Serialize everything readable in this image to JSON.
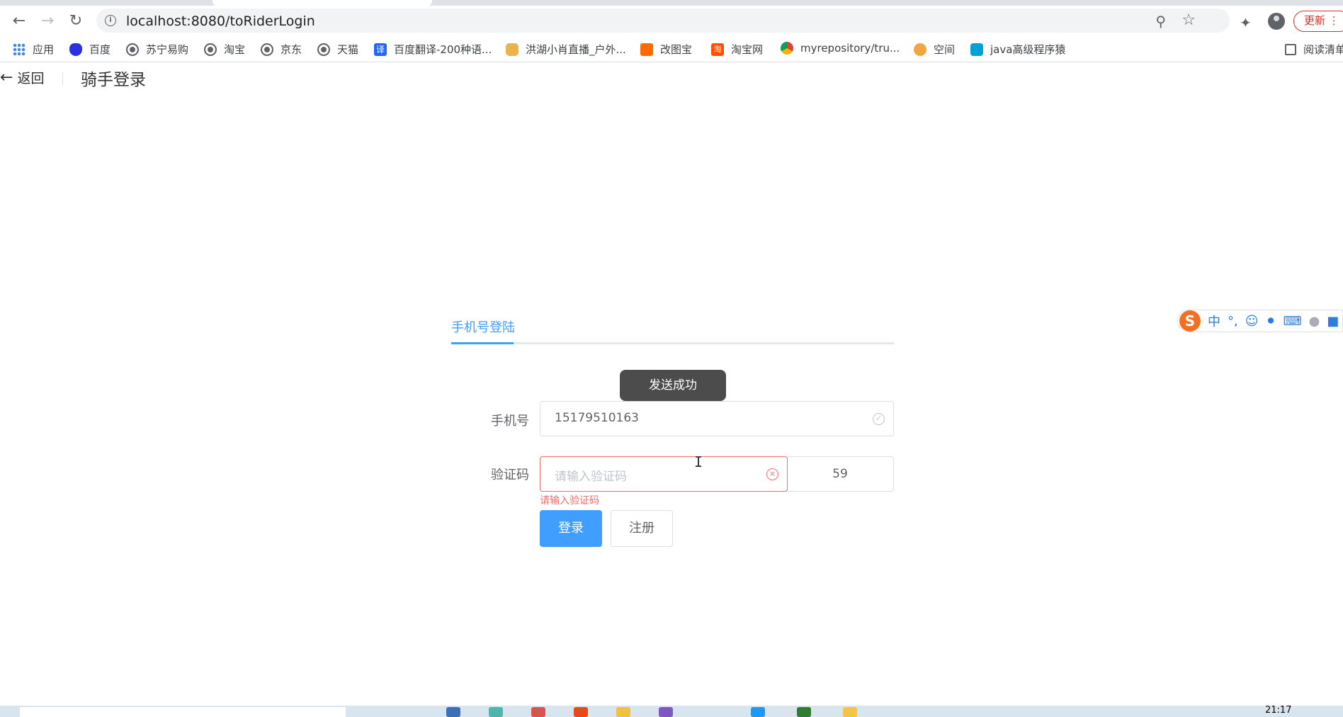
{
  "browser": {
    "url": "localhost:8080/toRiderLogin",
    "update_label": "更新",
    "bookmarks": [
      {
        "label": "应用",
        "icon": "apps-grid-icon"
      },
      {
        "label": "百度",
        "icon": "baidu-paw-icon"
      },
      {
        "label": "苏宁易购",
        "icon": "globe-icon"
      },
      {
        "label": "淘宝",
        "icon": "globe-icon"
      },
      {
        "label": "京东",
        "icon": "globe-icon"
      },
      {
        "label": "天猫",
        "icon": "globe-icon"
      },
      {
        "label": "百度翻译-200种语...",
        "icon": "baidu-translate-icon"
      },
      {
        "label": "洪湖小肖直播_户外...",
        "icon": "hh-icon"
      },
      {
        "label": "改图宝",
        "icon": "gaitubao-icon"
      },
      {
        "label": "淘宝网",
        "icon": "taobao-icon"
      },
      {
        "label": "myrepository/tru...",
        "icon": "chrome-icon"
      },
      {
        "label": "空间",
        "icon": "qzone-icon"
      },
      {
        "label": "java高级程序猿",
        "icon": "bilibili-icon"
      },
      {
        "label": "阅读清单",
        "icon": "reading-list-icon"
      }
    ]
  },
  "header": {
    "back_label": "返回",
    "title": "骑手登录"
  },
  "login": {
    "tab_label": "手机号登陆",
    "toast": "发送成功",
    "phone_label": "手机号",
    "phone_value": "15179510163",
    "code_label": "验证码",
    "code_placeholder": "请输入验证码",
    "countdown": "59",
    "code_error": "请输入验证码",
    "login_button": "登录",
    "register_button": "注册"
  },
  "ime": {
    "mode": "中",
    "punct": "°,"
  },
  "taskbar": {
    "time": "21:17"
  }
}
